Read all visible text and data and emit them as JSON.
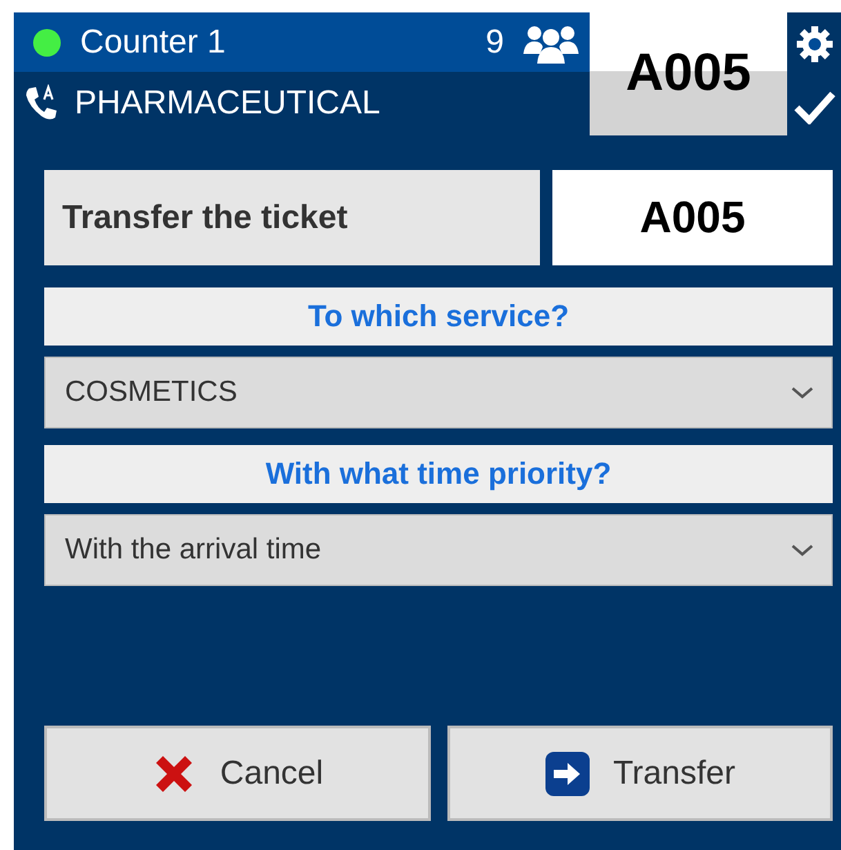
{
  "header": {
    "online": true,
    "counter": "Counter 1",
    "waiting_count": "9",
    "service": "PHARMACEUTICAL",
    "current_ticket": "A005"
  },
  "form": {
    "title": "Transfer the ticket",
    "ticket": "A005",
    "service_question": "To which service?",
    "service_select": {
      "value": "COSMETICS"
    },
    "priority_question": "With what time priority?",
    "priority_select": {
      "value": "With the arrival time"
    }
  },
  "buttons": [
    {
      "kind": "cancel",
      "label": "Cancel"
    },
    {
      "kind": "transfer",
      "label": "Transfer"
    }
  ]
}
